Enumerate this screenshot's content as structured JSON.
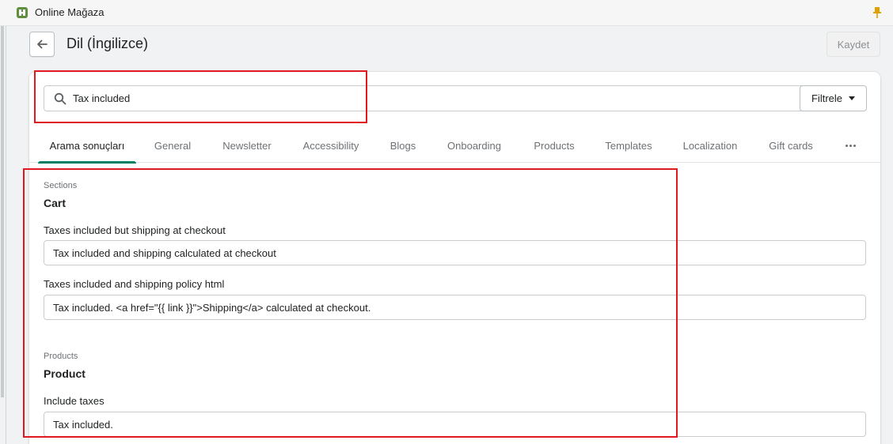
{
  "app": {
    "title": "Online Mağaza",
    "logo_icon": "shopify-bag-icon",
    "pin_icon": "pin-icon"
  },
  "header": {
    "back_icon": "arrow-left-icon",
    "title": "Dil (İngilizce)",
    "save_label": "Kaydet"
  },
  "search": {
    "value": "Tax included",
    "search_icon": "search-icon",
    "clear_icon": "clear-circle-icon",
    "filter_label": "Filtrele"
  },
  "tabs": [
    {
      "label": "Arama sonuçları",
      "active": true
    },
    {
      "label": "General",
      "active": false
    },
    {
      "label": "Newsletter",
      "active": false
    },
    {
      "label": "Accessibility",
      "active": false
    },
    {
      "label": "Blogs",
      "active": false
    },
    {
      "label": "Onboarding",
      "active": false
    },
    {
      "label": "Products",
      "active": false
    },
    {
      "label": "Templates",
      "active": false
    },
    {
      "label": "Localization",
      "active": false
    },
    {
      "label": "Gift cards",
      "active": false
    }
  ],
  "results": [
    {
      "caption": "Sections",
      "title": "Cart",
      "fields": [
        {
          "label": "Taxes included but shipping at checkout",
          "value": "Tax included and shipping calculated at checkout"
        },
        {
          "label": "Taxes included and shipping policy html",
          "value": "Tax included. <a href=\"{{ link }}\">Shipping</a> calculated at checkout."
        }
      ]
    },
    {
      "caption": "Products",
      "title": "Product",
      "fields": [
        {
          "label": "Include taxes",
          "value": "Tax included."
        }
      ]
    }
  ],
  "colors": {
    "accent": "#008060",
    "annotation": "#e0191e"
  }
}
